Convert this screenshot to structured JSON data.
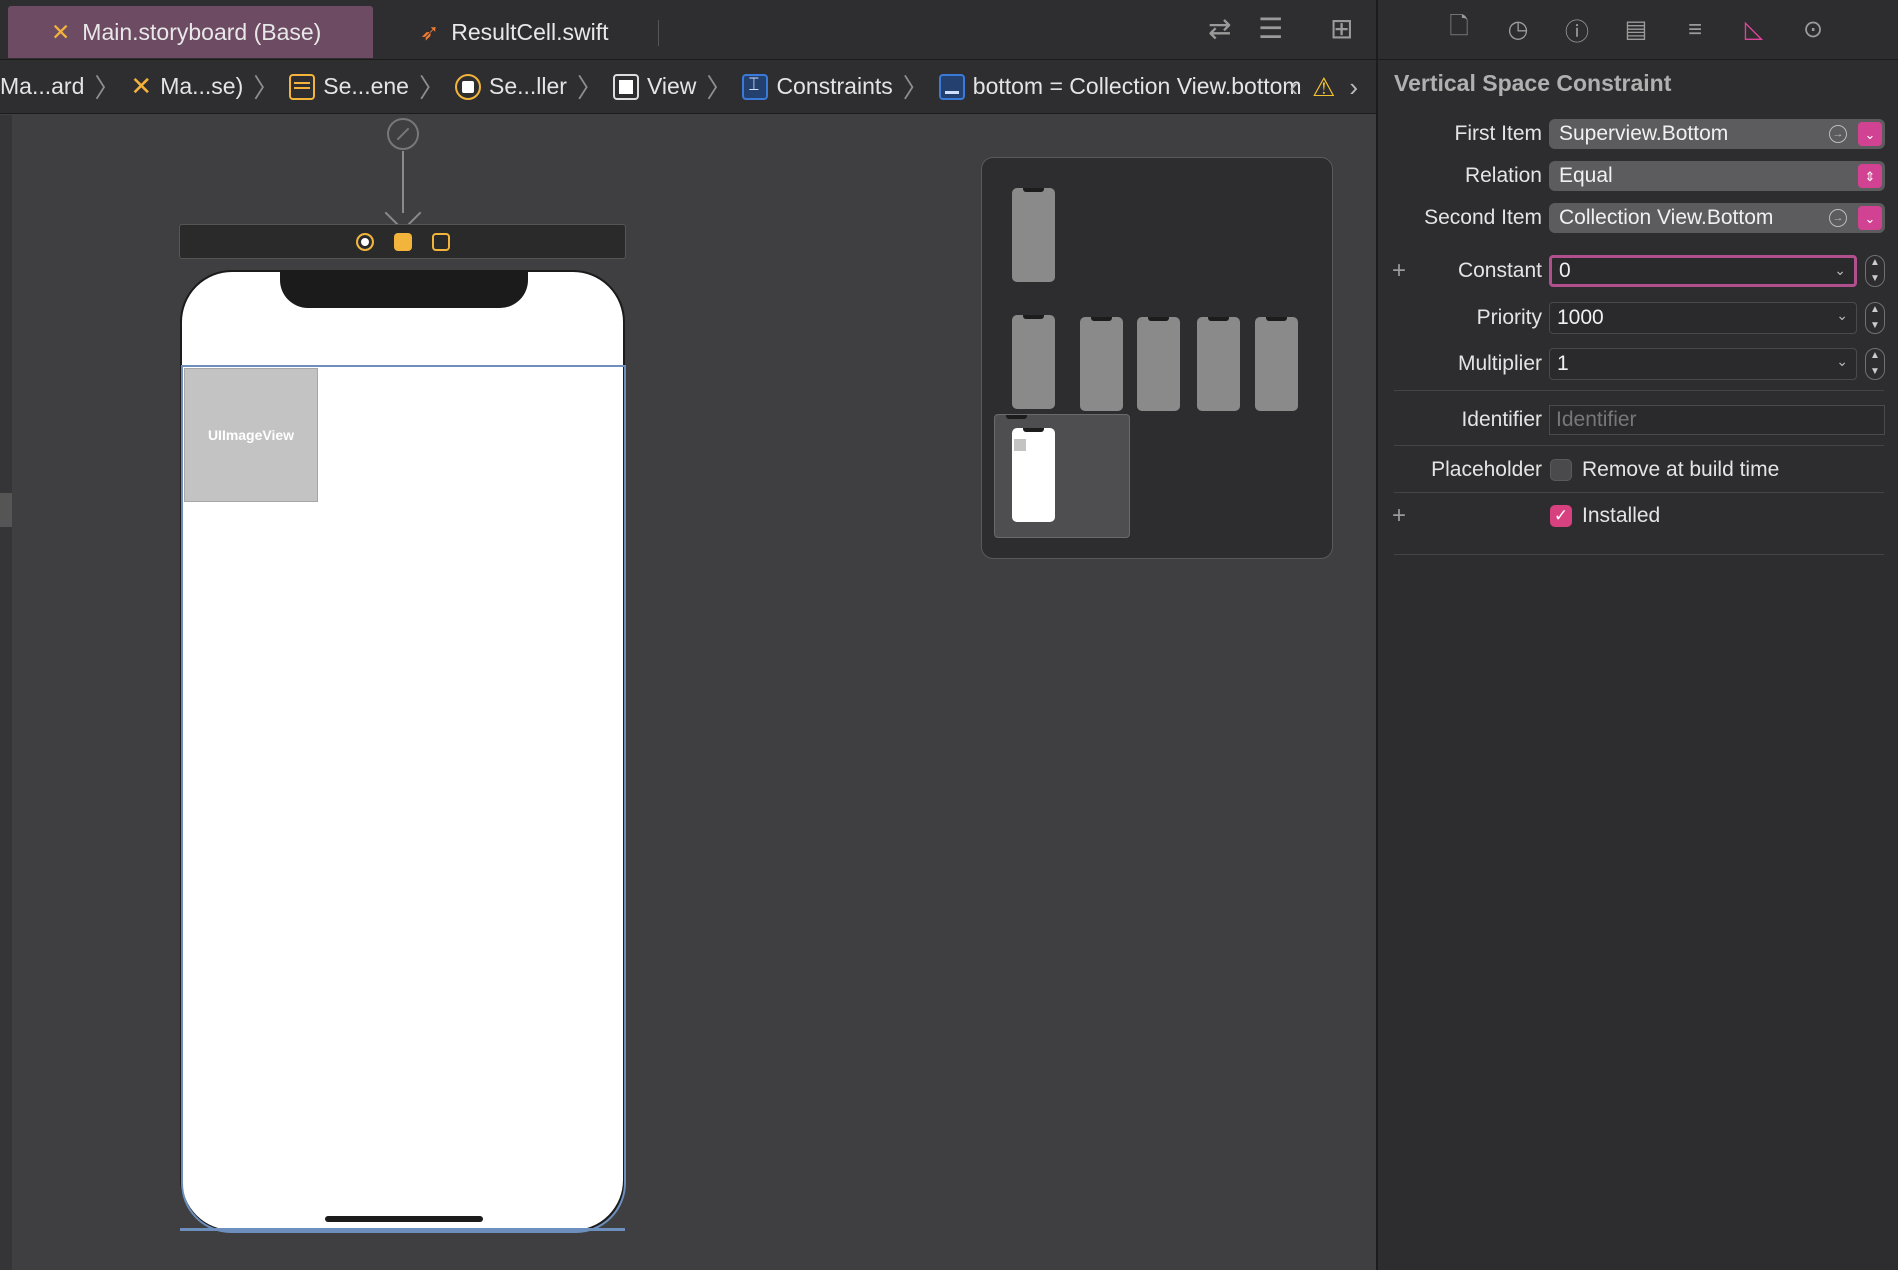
{
  "tabs": [
    {
      "label": "Main.storyboard (Base)",
      "active": true
    },
    {
      "label": "ResultCell.swift",
      "active": false
    }
  ],
  "jumpbar": {
    "items": [
      "Ma...ard",
      "Ma...se)",
      "Se...ene",
      "Se...ller",
      "View",
      "Constraints",
      "bottom = Collection View.bottom"
    ]
  },
  "canvas": {
    "image_view_label": "UIImageView"
  },
  "inspector": {
    "title": "Vertical Space Constraint",
    "first_item": {
      "label": "First Item",
      "value": "Superview.Bottom"
    },
    "relation": {
      "label": "Relation",
      "value": "Equal"
    },
    "second_item": {
      "label": "Second Item",
      "value": "Collection View.Bottom"
    },
    "constant": {
      "label": "Constant",
      "value": "0"
    },
    "priority": {
      "label": "Priority",
      "value": "1000"
    },
    "multiplier": {
      "label": "Multiplier",
      "value": "1"
    },
    "identifier": {
      "label": "Identifier",
      "placeholder": "Identifier"
    },
    "placeholder": {
      "label": "Placeholder",
      "checkbox_label": "Remove at build time",
      "checked": false
    },
    "installed": {
      "checkbox_label": "Installed",
      "checked": true
    }
  },
  "colors": {
    "accent": "#d8417f",
    "active_tab": "#6c4b63",
    "selection_outline": "#6d8fbd"
  }
}
